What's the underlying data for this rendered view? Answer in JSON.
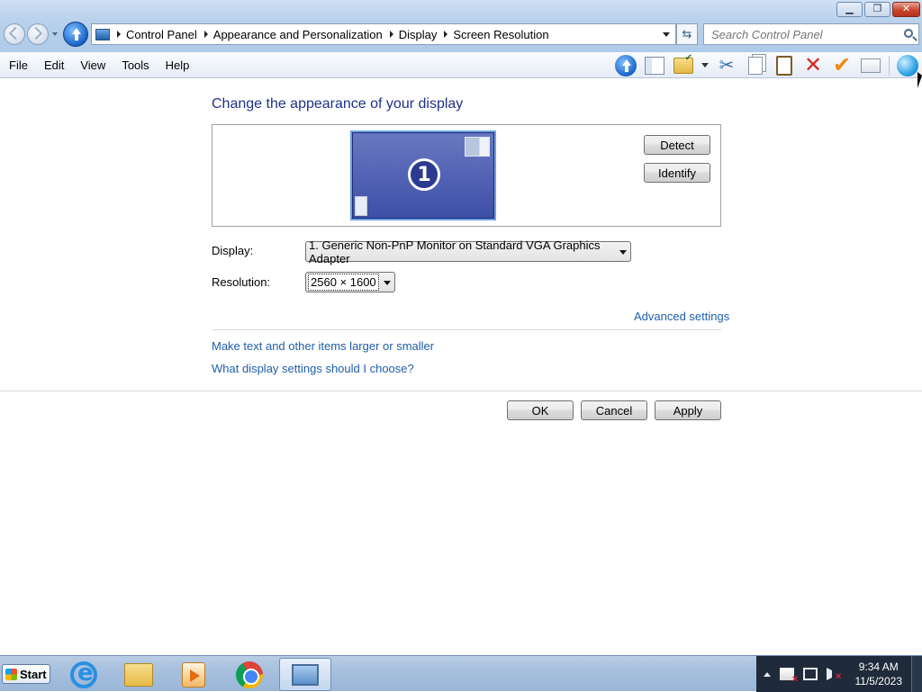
{
  "window": {
    "caption_buttons": {
      "minimize": "▁",
      "restore": "❐",
      "close": "✕"
    }
  },
  "nav": {
    "breadcrumbs": [
      "Control Panel",
      "Appearance and Personalization",
      "Display",
      "Screen Resolution"
    ],
    "search_placeholder": "Search Control Panel"
  },
  "menu": {
    "items": [
      "File",
      "Edit",
      "View",
      "Tools",
      "Help"
    ]
  },
  "toolbar": {
    "icons": [
      "up-icon",
      "pane-icon",
      "folder-options-icon",
      "cut-icon",
      "copy-icon",
      "paste-icon",
      "delete-icon",
      "check-icon",
      "properties-icon",
      "globe-icon"
    ],
    "cut_glyph": "✂",
    "delete_glyph": "✕",
    "ok_glyph": "✔"
  },
  "main": {
    "heading": "Change the appearance of your display",
    "monitor_number": "1",
    "detect_label": "Detect",
    "identify_label": "Identify",
    "display_label": "Display:",
    "display_value": "1. Generic Non-PnP Monitor on Standard VGA Graphics Adapter",
    "resolution_label": "Resolution:",
    "resolution_value": "2560 × 1600",
    "advanced_link": "Advanced settings",
    "link_text_size": "Make text and other items larger or smaller",
    "link_which_settings": "What display settings should I choose?",
    "ok_label": "OK",
    "cancel_label": "Cancel",
    "apply_label": "Apply"
  },
  "taskbar": {
    "start_label": "Start",
    "apps": [
      "internet-explorer-icon",
      "file-explorer-icon",
      "media-player-icon",
      "chrome-icon",
      "control-panel-icon"
    ],
    "time": "9:34 AM",
    "date": "11/5/2023"
  },
  "colors": {
    "heading": "#1e3287",
    "link": "#1f5ea8",
    "monitor": "#3d4ea6",
    "tray": "#1f2a3a"
  }
}
